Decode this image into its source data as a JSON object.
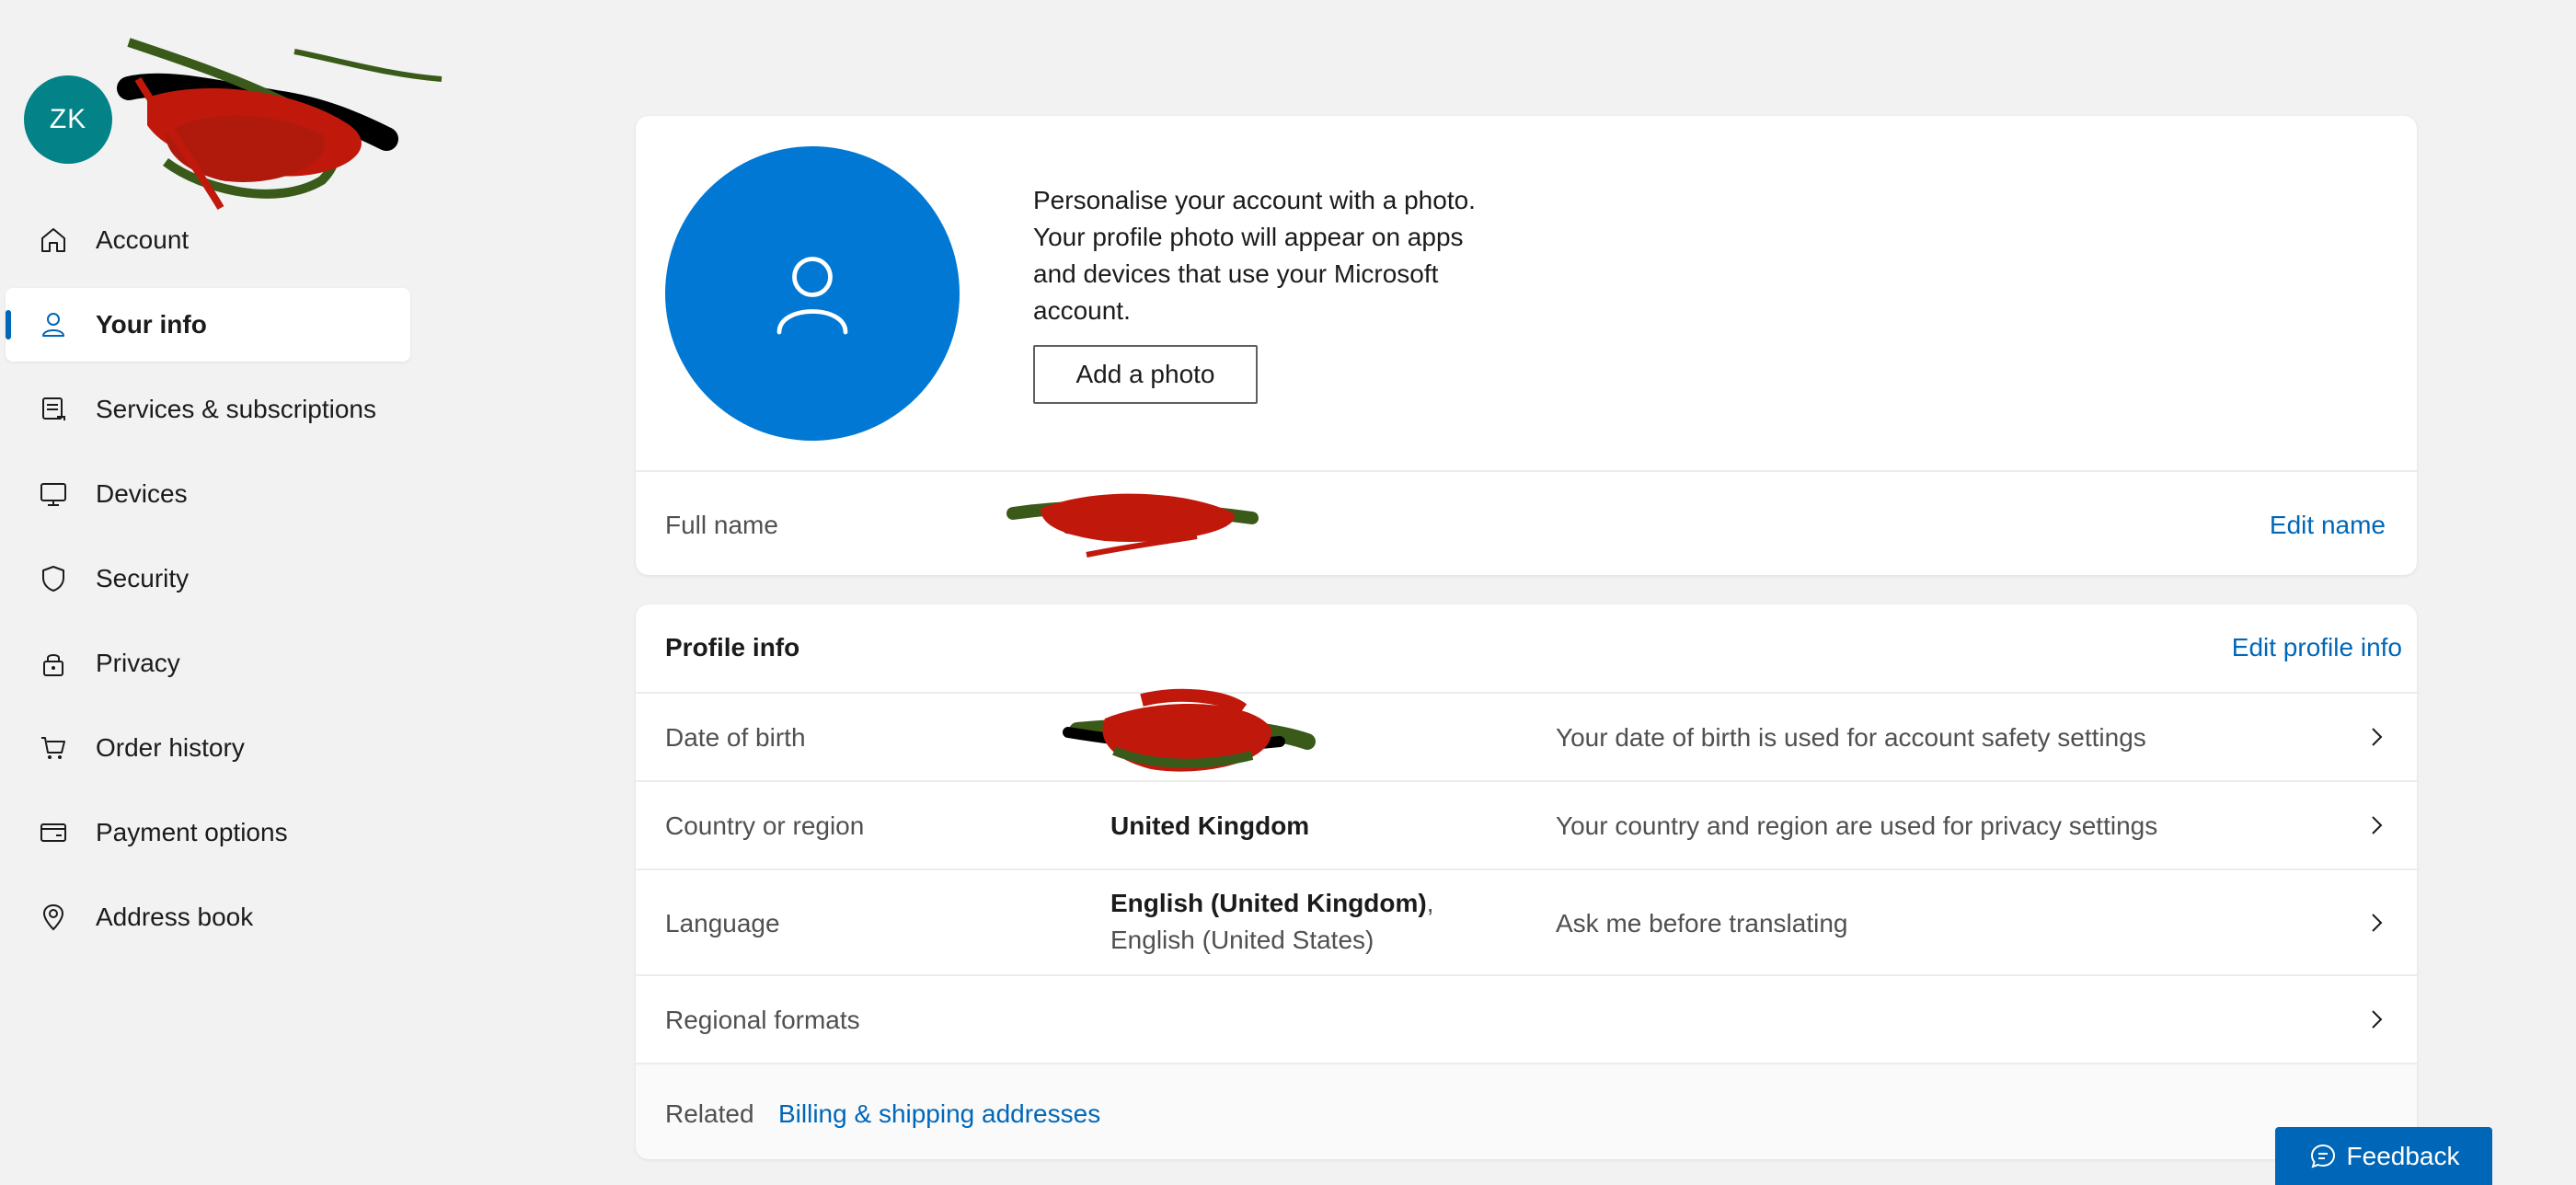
{
  "profile": {
    "initials": "ZK"
  },
  "sidebar": {
    "items": [
      {
        "label": "Account",
        "icon": "home-icon"
      },
      {
        "label": "Your info",
        "icon": "person-icon",
        "active": true
      },
      {
        "label": "Services & subscriptions",
        "icon": "subscriptions-icon"
      },
      {
        "label": "Devices",
        "icon": "monitor-icon"
      },
      {
        "label": "Security",
        "icon": "shield-icon"
      },
      {
        "label": "Privacy",
        "icon": "lock-icon"
      },
      {
        "label": "Order history",
        "icon": "cart-icon"
      },
      {
        "label": "Payment options",
        "icon": "card-icon"
      },
      {
        "label": "Address book",
        "icon": "location-pin-icon"
      }
    ]
  },
  "photo_card": {
    "description": "Personalise your account with a photo. Your profile photo will appear on apps and devices that use your Microsoft account.",
    "add_photo_label": "Add a photo",
    "full_name_label": "Full name",
    "edit_name_label": "Edit name"
  },
  "profile_info": {
    "title": "Profile info",
    "edit_label": "Edit profile info",
    "rows": [
      {
        "label": "Date of birth",
        "value": "",
        "description": "Your date of birth is used for account safety settings"
      },
      {
        "label": "Country or region",
        "value": "United Kingdom",
        "description": "Your country and region are used for privacy settings"
      },
      {
        "label": "Language",
        "value_primary": "English (United Kingdom)",
        "value_secondary": ", English (United States)",
        "description": "Ask me before translating"
      },
      {
        "label": "Regional formats",
        "value": "",
        "description": ""
      }
    ],
    "related_label": "Related",
    "related_link": "Billing & shipping addresses"
  },
  "feedback_label": "Feedback",
  "colors": {
    "accent": "#0067b8",
    "avatar": "#038387",
    "photo_circle": "#0078d4",
    "background": "#f2f2f2"
  }
}
